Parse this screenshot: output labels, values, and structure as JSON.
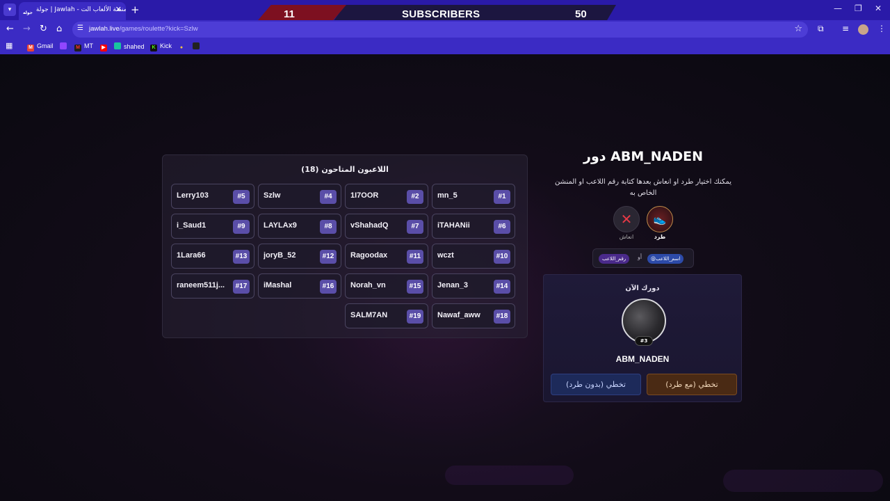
{
  "browser": {
    "tab_title": "جولة | Jawlah - منصة الألعاب الت...",
    "tab_favicon": "جوله",
    "url_host": "jawlah.live",
    "url_path": "/games/roulette?kick=Szlw",
    "bookmarks": [
      {
        "label": "Gmail",
        "icon": "gmail-icon",
        "color": "#ea4335"
      },
      {
        "label": "",
        "icon": "twitch-icon",
        "color": "#9146ff"
      },
      {
        "label": "MT",
        "icon": "mt-icon",
        "color": "#1e1e1e"
      },
      {
        "label": "",
        "icon": "youtube-icon",
        "color": "#ff0000"
      },
      {
        "label": "shahed",
        "icon": "shahed-icon",
        "color": "#19c6a0"
      },
      {
        "label": "Kick",
        "icon": "kick-icon",
        "color": "#53fc18"
      },
      {
        "label": "",
        "icon": "bulb-icon",
        "color": "#f5c542"
      },
      {
        "label": "",
        "icon": "app-icon",
        "color": "#222222"
      }
    ]
  },
  "overlay": {
    "left_count": "11",
    "label": "SUBSCRIBERS",
    "right_count": "50"
  },
  "players": {
    "title": "اللاعبون المتاحون (18)",
    "rows": [
      [
        {
          "name": "mn_5",
          "num": "#1"
        },
        {
          "name": "1I7OOR",
          "num": "#2"
        },
        {
          "name": "Szlw",
          "num": "#4"
        },
        {
          "name": "Lerry103",
          "num": "#5"
        }
      ],
      [
        {
          "name": "iTAHANii",
          "num": "#6"
        },
        {
          "name": "vShahadQ",
          "num": "#7"
        },
        {
          "name": "LAYLAx9",
          "num": "#8"
        },
        {
          "name": "i_Saud1",
          "num": "#9"
        }
      ],
      [
        {
          "name": "wczt",
          "num": "#10"
        },
        {
          "name": "Ragoodax",
          "num": "#11"
        },
        {
          "name": "joryB_52",
          "num": "#12"
        },
        {
          "name": "1Lara66",
          "num": "#13"
        }
      ],
      [
        {
          "name": "Jenan_3",
          "num": "#14"
        },
        {
          "name": "Norah_vn",
          "num": "#15"
        },
        {
          "name": "iMashal",
          "num": "#16"
        },
        {
          "name": "raneem511j...",
          "num": "#17"
        }
      ],
      [
        {
          "name": "Nawaf_aww",
          "num": "#18"
        },
        {
          "name": "SALM7AN",
          "num": "#19"
        }
      ]
    ]
  },
  "turn": {
    "title": "دور ABM_NADEN",
    "description": "يمكنك اختيار طرد او انعاش بعدها كتابة رقم اللاعب او المنشن الخاص به",
    "kick_label": "طرد",
    "revive_label": "انعاش",
    "hint_mention": "@اسم_اللاعب",
    "hint_or": "أو",
    "hint_number": "رقم_اللاعب"
  },
  "current": {
    "label": "دورك الآن",
    "badge": "#3",
    "name": "ABM_NADEN",
    "skip_with_kick": "تخطي (مع طرد)",
    "skip_without_kick": "تخطي (بدون طرد)"
  }
}
